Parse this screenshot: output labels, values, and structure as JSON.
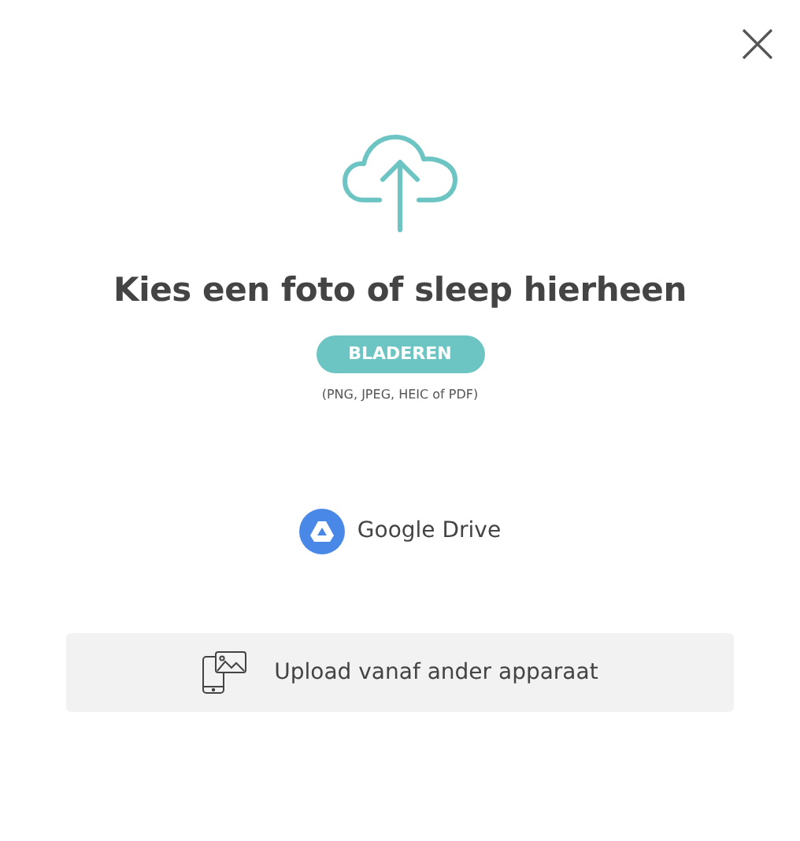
{
  "title": "Kies een foto of sleep hierheen",
  "browse_button": {
    "label": "BLADEREN"
  },
  "formats_note": "(PNG, JPEG, HEIC of PDF)",
  "sources": [
    {
      "kind": "drive",
      "label": "Google Drive"
    },
    {
      "kind": "device",
      "label": "Upload vanaf ander apparaat"
    }
  ]
}
